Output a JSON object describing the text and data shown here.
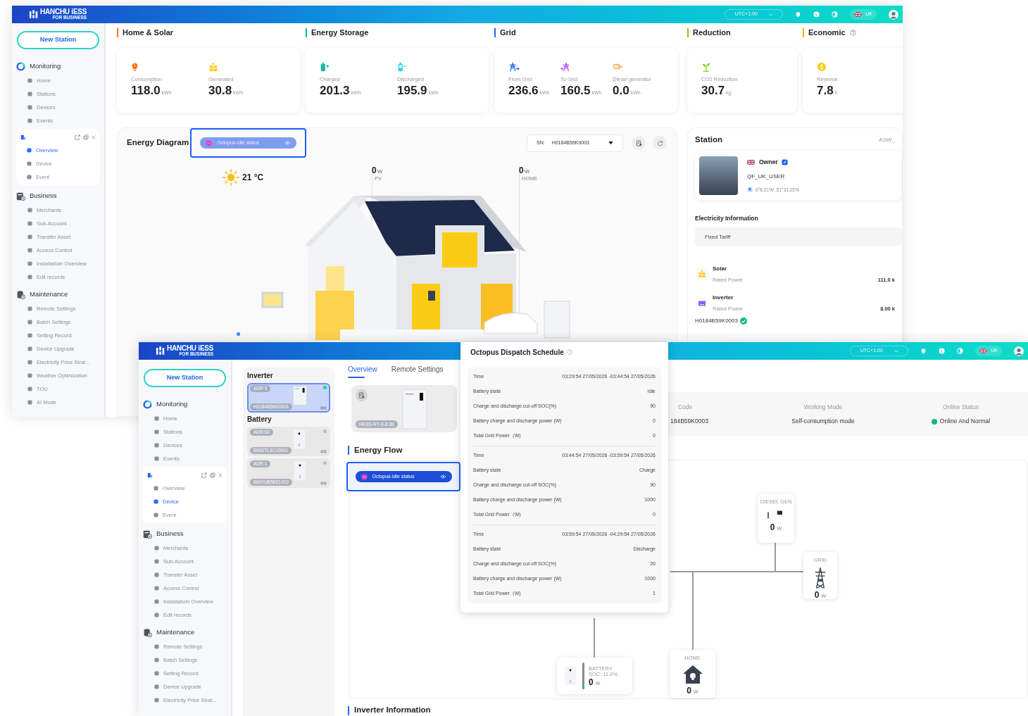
{
  "back_window": {
    "header": {
      "brand": "HANCHU iESS",
      "brand_sub": "FOR BUSINESS",
      "timezone": "UTC+1:00",
      "language": "UK"
    },
    "sidebar": {
      "new_station": "New Station",
      "groups": [
        {
          "kind": "monitoring",
          "title": "Monitoring",
          "items": [
            {
              "label": "Home",
              "selected": false
            },
            {
              "label": "Stations",
              "selected": false
            },
            {
              "label": "Devices",
              "selected": false
            },
            {
              "label": "Events",
              "selected": false
            }
          ]
        },
        {
          "kind": "station",
          "items": [
            {
              "label": "Overview",
              "selected": true
            },
            {
              "label": "Device",
              "selected": false
            },
            {
              "label": "Event",
              "selected": false
            }
          ]
        },
        {
          "kind": "business",
          "title": "Business",
          "items": [
            {
              "label": "Merchants",
              "selected": false
            },
            {
              "label": "Sub-Account",
              "selected": false
            },
            {
              "label": "Transfer Asset",
              "selected": false
            },
            {
              "label": "Access Control",
              "selected": false
            },
            {
              "label": "Installatioin Overview",
              "selected": false
            },
            {
              "label": "Edit records",
              "selected": false
            }
          ]
        },
        {
          "kind": "maintenance",
          "title": "Maintenance",
          "items": [
            {
              "label": "Remote Settings",
              "selected": false
            },
            {
              "label": "Batch Settings",
              "selected": false
            },
            {
              "label": "Setting Record",
              "selected": false
            },
            {
              "label": "Device Upgrade",
              "selected": false
            },
            {
              "label": "Electricity Price Strat...",
              "selected": false
            },
            {
              "label": "Weather Optimization",
              "selected": false
            },
            {
              "label": "TOU",
              "selected": false
            },
            {
              "label": "AI Mode",
              "selected": false
            }
          ]
        }
      ]
    },
    "summary": [
      {
        "title": "Home & Solar",
        "color": "#f97316",
        "help": false,
        "stats": [
          {
            "kind": "bulb",
            "label": "Consumption",
            "value": "118.0",
            "unit": "kWh"
          },
          {
            "kind": "solar",
            "label": "Generated",
            "value": "30.8",
            "unit": "kWh"
          }
        ]
      },
      {
        "title": "Energy Storage",
        "color": "#14b8a6",
        "help": false,
        "stats": [
          {
            "kind": "charge",
            "label": "Charged",
            "value": "201.3",
            "unit": "kWh"
          },
          {
            "kind": "discharge",
            "label": "Discharged",
            "value": "195.9",
            "unit": "kWh"
          }
        ]
      },
      {
        "title": "Grid",
        "color": "#2563eb",
        "help": false,
        "stats": [
          {
            "kind": "from_grid",
            "label": "From Grid",
            "value": "236.6",
            "unit": "kWh"
          },
          {
            "kind": "to_grid",
            "label": "To Grid",
            "value": "160.5",
            "unit": "kWh"
          },
          {
            "kind": "diesel",
            "label": "Diesel generator",
            "value": "0.0",
            "unit": "kWh"
          }
        ]
      },
      {
        "title": "Reduction",
        "color": "#84cc16",
        "help": false,
        "stats": [
          {
            "kind": "co2",
            "label": "CO2 Reduction",
            "value": "30.7",
            "unit": "kg"
          }
        ]
      },
      {
        "title": "Economic",
        "color": "#eab308",
        "help": true,
        "stats": [
          {
            "kind": "revenue",
            "label": "Revenue",
            "value": "7.8",
            "unit": "£"
          }
        ]
      }
    ],
    "energy_diagram": {
      "title": "Energy Diagram",
      "status_badge": "Octopus-idle status",
      "sn_label": "SN:",
      "sn_value": "H0184B59K0003",
      "temperature": "21 °C",
      "readings": [
        {
          "value": "0",
          "unit": "W",
          "label": "PV"
        },
        {
          "value": "0",
          "unit": "W",
          "label": "HOME"
        }
      ]
    },
    "station": {
      "title": "Station",
      "code": "ASW_",
      "owner": "Owner",
      "user": "QF_UK_USER",
      "coordinates": "0°8.21'W ,51°31.25'N",
      "electricity_title": "Electricity Information",
      "tariff": "Fixed Tariff",
      "devices": [
        {
          "kind": "solar",
          "name": "Solar",
          "label": "Rated Power",
          "value": "111.0 k"
        },
        {
          "kind": "inverter",
          "name": "Inverter",
          "label": "Rated Power",
          "value": "8.00 k"
        }
      ],
      "serial": "H0184B59K0003"
    }
  },
  "front_window": {
    "header": {
      "brand": "HANCHU iESS",
      "brand_sub": "FOR BUSINESS",
      "timezone": "UTC+1:00",
      "language": "UK"
    },
    "sidebar": {
      "new_station": "New Station",
      "groups": [
        {
          "kind": "monitoring",
          "title": "Monitoring",
          "items": [
            {
              "label": "Home",
              "selected": false
            },
            {
              "label": "Stations",
              "selected": false
            },
            {
              "label": "Devices",
              "selected": false
            },
            {
              "label": "Events",
              "selected": false
            }
          ]
        },
        {
          "kind": "station",
          "items": [
            {
              "label": "Overview",
              "selected": false
            },
            {
              "label": "Device",
              "selected": true
            },
            {
              "label": "Event",
              "selected": false
            }
          ]
        },
        {
          "kind": "business",
          "title": "Business",
          "items": [
            {
              "label": "Merchants",
              "selected": false
            },
            {
              "label": "Sub-Account",
              "selected": false
            },
            {
              "label": "Transfer Asset",
              "selected": false
            },
            {
              "label": "Access Control",
              "selected": false
            },
            {
              "label": "Installatioin Overview",
              "selected": false
            },
            {
              "label": "Edit records",
              "selected": false
            }
          ]
        },
        {
          "kind": "maintenance",
          "title": "Maintenance",
          "items": [
            {
              "label": "Remote Settings",
              "selected": false
            },
            {
              "label": "Batch Settings",
              "selected": false
            },
            {
              "label": "Setting Record",
              "selected": false
            },
            {
              "label": "Device Upgrade",
              "selected": false
            },
            {
              "label": "Electricity Price Strat...",
              "selected": false
            }
          ]
        }
      ]
    },
    "device_list": [
      {
        "title": "Inverter",
        "devices": [
          {
            "address": "ADR:3",
            "serial": "H0184B59K0003",
            "selected": true,
            "online": true
          }
        ]
      },
      {
        "title": "Battery",
        "devices": [
          {
            "address": "ADR:02",
            "serial": "B002TL3C10001",
            "selected": false,
            "online": false
          },
          {
            "address": "ADR:1",
            "serial": "B007UB58S1012",
            "selected": false,
            "online": false
          }
        ]
      }
    ],
    "tabs": [
      {
        "label": "Overview",
        "selected": true
      },
      {
        "label": "Remote Settings",
        "selected": false
      }
    ],
    "device_model": "HESS-HY-S-8.0K",
    "info": {
      "code_label": "Code",
      "code_value": "184B59K0003",
      "mode_label": "Working Mode",
      "mode_value": "Self-consumption mode",
      "status_label": "Online Status",
      "status_value": "Online And Normal",
      "online": true
    },
    "energy_flow": {
      "title": "Energy Flow",
      "status_badge": "Octopus-idle status",
      "nodes": [
        {
          "kind": "diesel",
          "label": "DIESEL GEN",
          "value": "0",
          "unit": "W"
        },
        {
          "kind": "grid",
          "label": "GRID",
          "value": "0",
          "unit": "W"
        },
        {
          "kind": "battery",
          "label": "BATTERY",
          "soc": "SOC: 11.0%",
          "value": "0",
          "unit": "W",
          "level": 0.11
        },
        {
          "kind": "home",
          "label": "HOME",
          "value": "0",
          "unit": "W"
        }
      ]
    },
    "next_section": "Inverter Information"
  },
  "dispatch_schedule": {
    "title": "Octopus Dispatch Schedule",
    "entries": [
      {
        "rows": [
          {
            "label": "Time",
            "value": "03:29:54 27/05/2026 -03:44:54 27/05/2026"
          },
          {
            "label": "Battery state",
            "value": "Idle"
          },
          {
            "label": "Charge and discharge cut-off SOC(%)",
            "value": "90"
          },
          {
            "label": "Battery charge and discharge power (W)",
            "value": "0"
          },
          {
            "label": "Total Grid Power（W)",
            "value": "0"
          }
        ]
      },
      {
        "rows": [
          {
            "label": "Time",
            "value": "03:44:54 27/05/2026 -03:59:54 27/05/2026"
          },
          {
            "label": "Battery state",
            "value": "Charge"
          },
          {
            "label": "Charge and discharge cut-off SOC(%)",
            "value": "90"
          },
          {
            "label": "Battery charge and discharge power (W)",
            "value": "1000"
          },
          {
            "label": "Total Grid Power（W)",
            "value": "0"
          }
        ]
      },
      {
        "rows": [
          {
            "label": "Time",
            "value": "03:59:54 27/05/2026 -04:29:54 27/05/2026"
          },
          {
            "label": "Battery state",
            "value": "Discharge"
          },
          {
            "label": "Charge and discharge cut-off SOC(%)",
            "value": "20"
          },
          {
            "label": "Battery charge and discharge power (W)",
            "value": "1000"
          },
          {
            "label": "Total Grid Power（W)",
            "value": "1"
          }
        ]
      }
    ]
  }
}
